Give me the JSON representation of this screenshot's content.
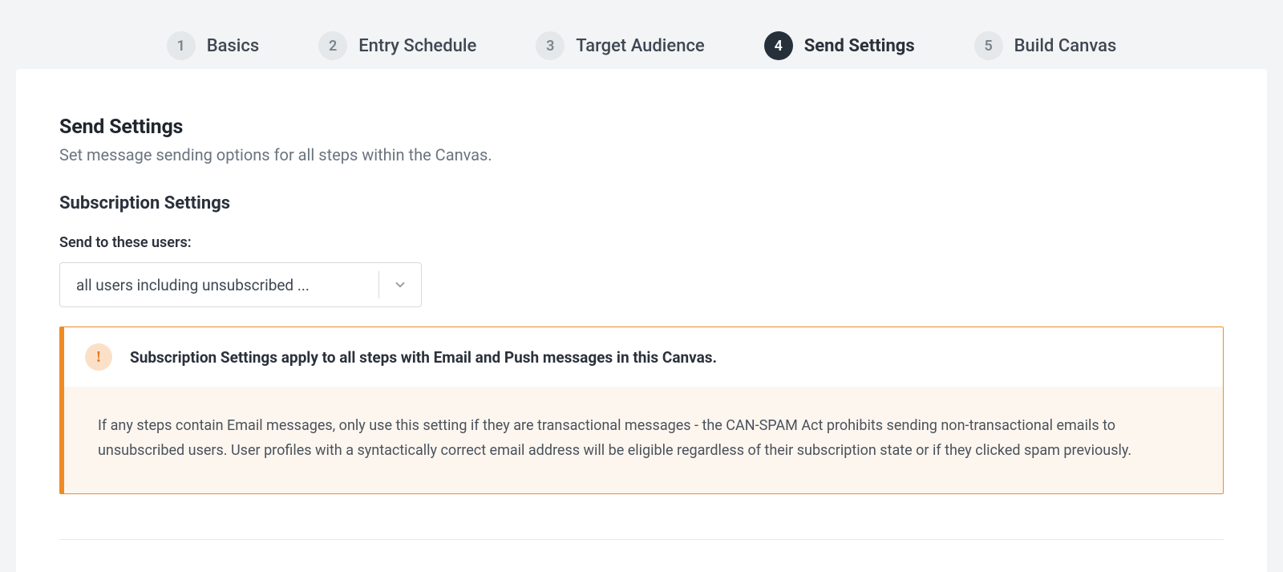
{
  "stepper": {
    "steps": [
      {
        "num": "1",
        "label": "Basics"
      },
      {
        "num": "2",
        "label": "Entry Schedule"
      },
      {
        "num": "3",
        "label": "Target Audience"
      },
      {
        "num": "4",
        "label": "Send Settings"
      },
      {
        "num": "5",
        "label": "Build Canvas"
      }
    ],
    "active_index": 3
  },
  "main": {
    "title": "Send Settings",
    "subtitle": "Set message sending options for all steps within the Canvas.",
    "subscription": {
      "section_title": "Subscription Settings",
      "field_label": "Send to these users:",
      "select_value": "all users including unsubscribed ..."
    },
    "alert": {
      "icon_glyph": "!",
      "title": "Subscription Settings apply to all steps with Email and Push messages in this Canvas.",
      "body": "If any steps contain Email messages, only use this setting if they are transactional messages - the CAN-SPAM Act prohibits sending non-transactional emails to unsubscribed users. User profiles with a syntactically correct email address will be eligible regardless of their subscription state or if they clicked spam previously."
    }
  }
}
